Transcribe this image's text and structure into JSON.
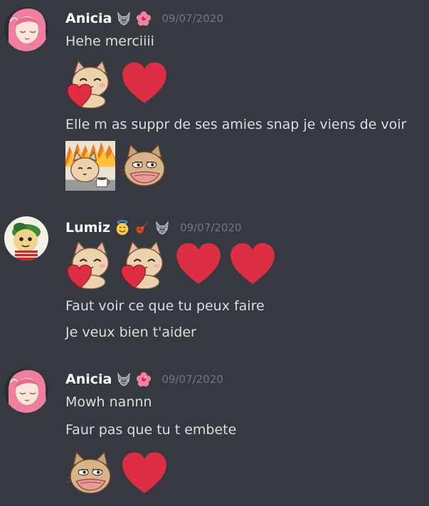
{
  "messages": [
    {
      "author": "Anicia",
      "timestamp": "09/07/2020",
      "badges": [
        "wolf-badge-icon",
        "hibiscus-badge-icon"
      ],
      "lines": [
        "Hehe merciiii",
        "Elle m as suppr de ses amies snap je viens de voir"
      ],
      "emotes_1": [
        "cat-holding-heart-emote",
        "red-heart-emote"
      ],
      "emotes_2": [
        "cat-this-is-fine-emote",
        "cat-pepe-emote"
      ]
    },
    {
      "author": "Lumiz",
      "timestamp": "09/07/2020",
      "badges": [
        "smiling-halo-badge-icon",
        "guitar-badge-icon",
        "wolf-badge-icon"
      ],
      "emotes_1": [
        "cat-holding-heart-emote",
        "cat-holding-heart-emote",
        "red-heart-emote",
        "red-heart-emote"
      ],
      "lines": [
        "Faut voir ce que tu peux faire",
        "Je veux bien t'aider"
      ]
    },
    {
      "author": "Anicia",
      "timestamp": "09/07/2020",
      "badges": [
        "wolf-badge-icon",
        "hibiscus-badge-icon"
      ],
      "lines": [
        "Mowh nannn",
        "Faur pas que tu t embete"
      ],
      "emotes_1": [
        "cat-pepe-emote",
        "red-heart-emote"
      ]
    }
  ],
  "colors": {
    "background": "#36393f",
    "username": "#ffffff",
    "message_text": "#dcddde",
    "timestamp": "#72767d",
    "heart": "#dd2e44"
  }
}
